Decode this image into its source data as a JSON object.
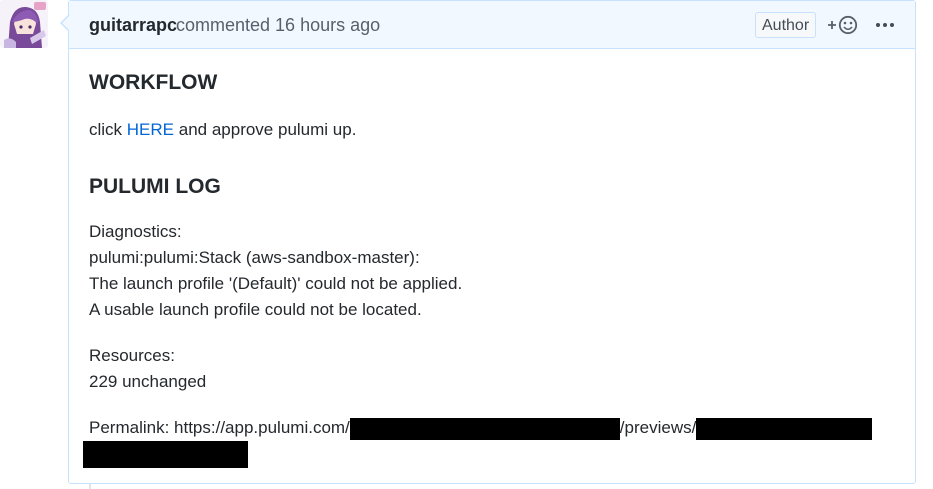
{
  "comment": {
    "author": "guitarrapc",
    "action": "commented 16 hours ago",
    "badge": "Author",
    "workflow_heading": "WORKFLOW",
    "workflow_click": "click ",
    "workflow_link": "HERE",
    "workflow_rest": " and approve pulumi up.",
    "log_heading": "PULUMI LOG",
    "diagnostics": [
      "Diagnostics:",
      "pulumi:pulumi:Stack (aws-sandbox-master):",
      "The launch profile '(Default)' could not be applied.",
      "A usable launch profile could not be located."
    ],
    "resources": [
      "Resources:",
      "229 unchanged"
    ],
    "permalink_label": "Permalink: ",
    "permalink_url_a": "https://app.pulumi.com/",
    "permalink_url_b": "/previews/"
  },
  "icons": {
    "reaction": "smiley-add-icon",
    "more": "kebab-horizontal-icon",
    "avatar": "user-avatar"
  },
  "colors": {
    "header_bg": "#f1f8ff",
    "border": "#c8e1ff",
    "link": "#0366d6"
  }
}
